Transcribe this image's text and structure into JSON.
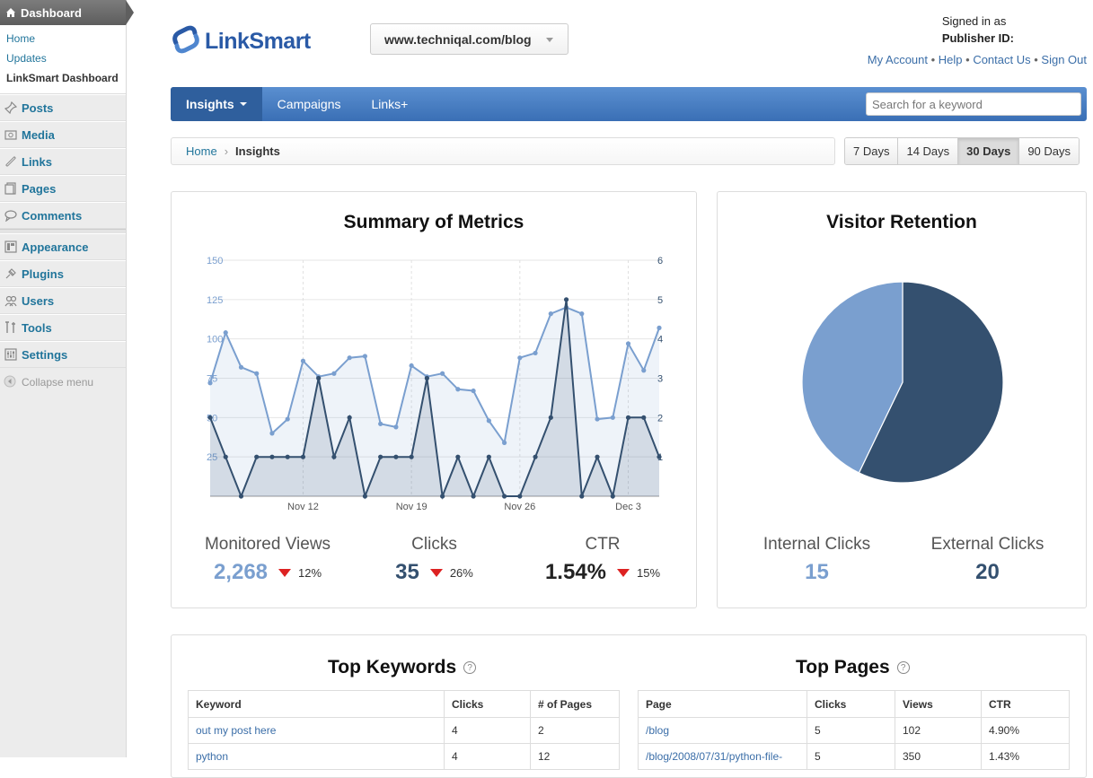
{
  "wp": {
    "dashboard_label": "Dashboard",
    "submenu": [
      "Home",
      "Updates",
      "LinkSmart Dashboard"
    ],
    "menu1": [
      {
        "label": "Posts",
        "icon": "pin-icon"
      },
      {
        "label": "Media",
        "icon": "media-icon"
      },
      {
        "label": "Links",
        "icon": "link-icon"
      },
      {
        "label": "Pages",
        "icon": "pages-icon"
      },
      {
        "label": "Comments",
        "icon": "comment-icon"
      }
    ],
    "menu2": [
      {
        "label": "Appearance",
        "icon": "appearance-icon"
      },
      {
        "label": "Plugins",
        "icon": "plugin-icon"
      },
      {
        "label": "Users",
        "icon": "users-icon"
      },
      {
        "label": "Tools",
        "icon": "tools-icon"
      },
      {
        "label": "Settings",
        "icon": "settings-icon"
      }
    ],
    "collapse_label": "Collapse menu"
  },
  "header": {
    "logo_text": "LinkSmart",
    "site": "www.techniqal.com/blog",
    "signed_in": "Signed in as",
    "publisher": "Publisher ID:",
    "links": [
      "My Account",
      "Help",
      "Contact Us",
      "Sign Out"
    ]
  },
  "nav": {
    "items": [
      "Insights",
      "Campaigns",
      "Links+"
    ],
    "search_placeholder": "Search for a keyword"
  },
  "breadcrumb": {
    "home": "Home",
    "current": "Insights"
  },
  "ranges": [
    "7 Days",
    "14 Days",
    "30 Days",
    "90 Days"
  ],
  "metrics": {
    "title": "Summary of Metrics",
    "items": [
      {
        "label": "Monitored Views",
        "value": "2,268",
        "change": "12%",
        "color": "#7a9fcf"
      },
      {
        "label": "Clicks",
        "value": "35",
        "change": "26%",
        "color": "#34506f"
      },
      {
        "label": "CTR",
        "value": "1.54%",
        "change": "15%",
        "color": "#222222"
      }
    ]
  },
  "chart_data": {
    "type": "area",
    "x_ticks": [
      "Nov 12",
      "Nov 19",
      "Nov 26",
      "Dec 3"
    ],
    "y_left_ticks": [
      "150",
      "125",
      "100",
      "75",
      "50",
      "25"
    ],
    "y_right_ticks": [
      "6",
      "5",
      "4",
      "3",
      "2",
      "1"
    ],
    "ylim_left": [
      0,
      150
    ],
    "ylim_right": [
      0,
      6
    ],
    "series": [
      {
        "color": "#7a9fcf",
        "axis": "left",
        "values": [
          72,
          104,
          82,
          78,
          40,
          49,
          86,
          76,
          78,
          88,
          89,
          46,
          44,
          83,
          76,
          78,
          68,
          67,
          48,
          34,
          88,
          91,
          116,
          120,
          116,
          49,
          50,
          97,
          80,
          107
        ]
      },
      {
        "color": "#34506f",
        "axis": "right",
        "values": [
          2,
          1,
          0,
          1,
          1,
          1,
          1,
          3,
          1,
          2,
          0,
          1,
          1,
          1,
          3,
          0,
          1,
          0,
          1,
          0,
          0,
          1,
          2,
          5,
          0,
          1,
          0,
          2,
          2,
          1
        ]
      }
    ]
  },
  "retention": {
    "title": "Visitor Retention",
    "internal_label": "Internal Clicks",
    "internal_value": "15",
    "external_label": "External Clicks",
    "external_value": "20",
    "internal_color": "#7a9fcf",
    "external_color": "#34506f",
    "pie": {
      "internal": 15,
      "external": 20
    }
  },
  "keywords": {
    "title": "Top Keywords",
    "headers": [
      "Keyword",
      "Clicks",
      "# of Pages"
    ],
    "rows": [
      [
        "out my post here",
        "4",
        "2"
      ],
      [
        "python",
        "4",
        "12"
      ]
    ]
  },
  "pages": {
    "title": "Top Pages",
    "headers": [
      "Page",
      "Clicks",
      "Views",
      "CTR"
    ],
    "rows": [
      [
        "/blog",
        "5",
        "102",
        "4.90%"
      ],
      [
        "/blog/2008/07/31/python-file-",
        "5",
        "350",
        "1.43%"
      ]
    ]
  }
}
